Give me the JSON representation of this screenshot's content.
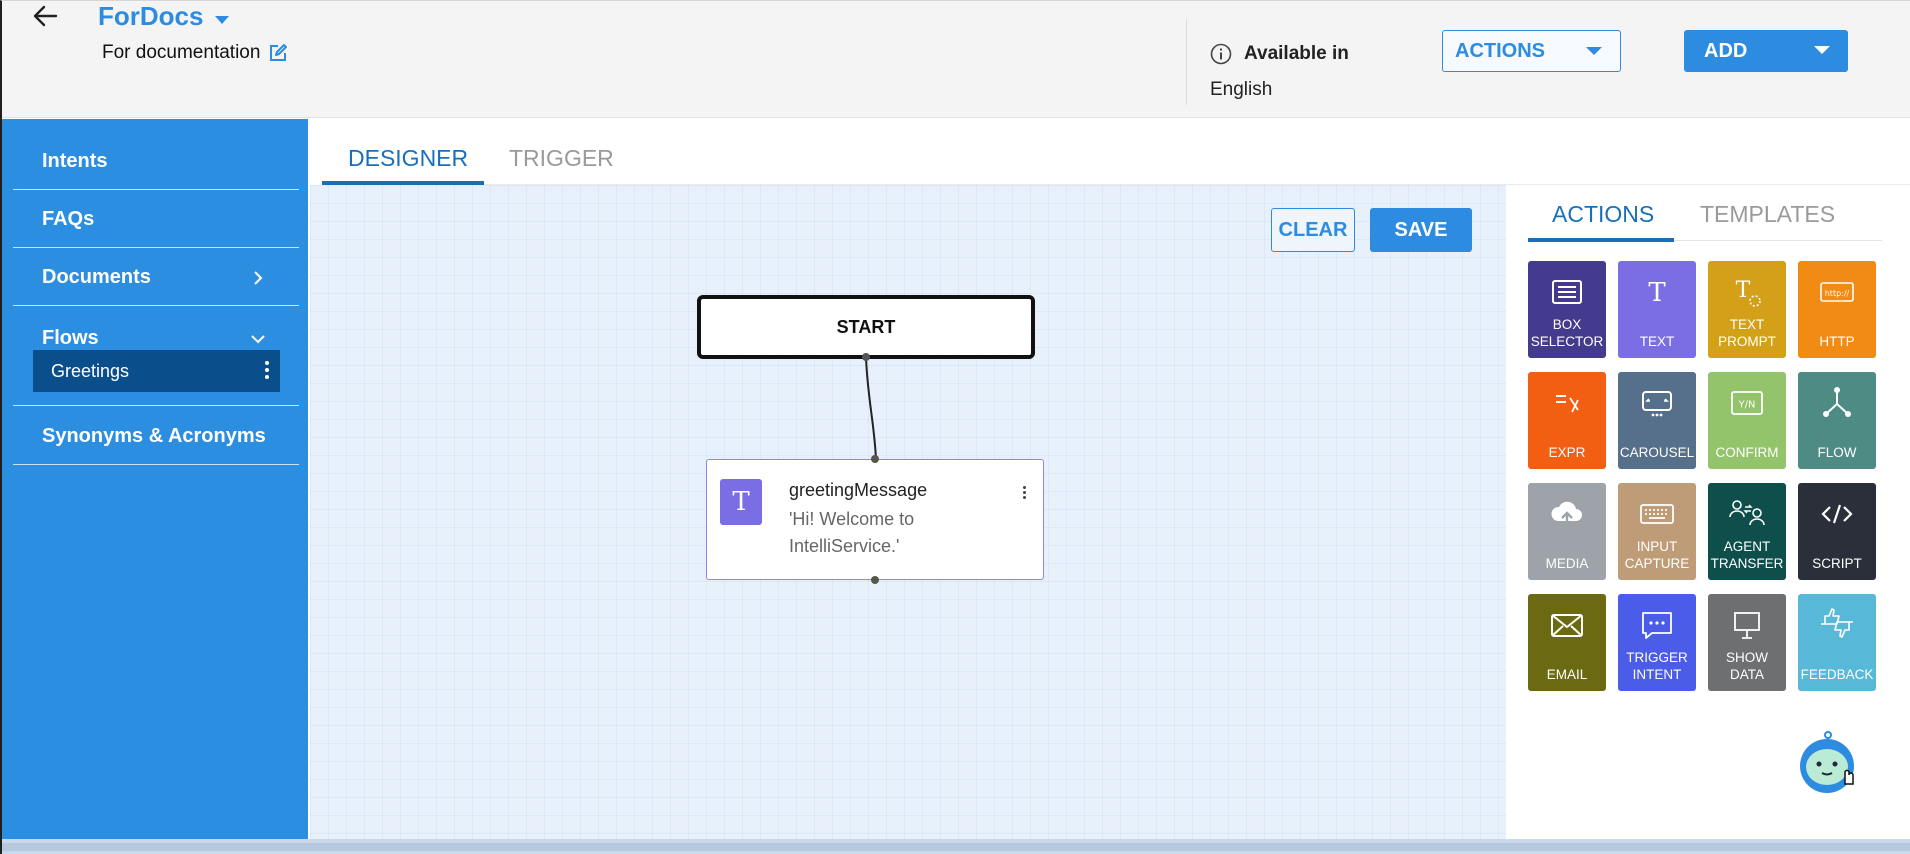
{
  "header": {
    "title": "ForDocs",
    "subtitle": "For documentation",
    "available_label": "Available in",
    "available_language": "English",
    "actions_label": "ACTIONS",
    "add_label": "ADD"
  },
  "sidebar": {
    "items": [
      {
        "label": "Intents"
      },
      {
        "label": "FAQs"
      },
      {
        "label": "Documents"
      },
      {
        "label": "Flows"
      },
      {
        "label": "Synonyms & Acronyms"
      }
    ],
    "flows_children": [
      {
        "label": "Greetings"
      }
    ]
  },
  "main": {
    "tabs": [
      {
        "label": "DESIGNER"
      },
      {
        "label": "TRIGGER"
      }
    ],
    "clear_label": "CLEAR",
    "save_label": "SAVE"
  },
  "canvas": {
    "start_label": "START",
    "nodes": [
      {
        "icon_letter": "T",
        "title": "greetingMessage",
        "text": "'Hi! Welcome to IntelliService.'"
      }
    ]
  },
  "right_panel": {
    "tabs": [
      {
        "label": "ACTIONS"
      },
      {
        "label": "TEMPLATES"
      }
    ],
    "tiles": [
      {
        "label": "BOX SELECTOR",
        "color": "#443a8e",
        "icon": "list-box-icon"
      },
      {
        "label": "TEXT",
        "color": "#7b6ee5",
        "icon": "text-icon"
      },
      {
        "label": "TEXT PROMPT",
        "color": "#d4a017",
        "icon": "text-prompt-icon"
      },
      {
        "label": "HTTP",
        "color": "#f28b13",
        "icon": "http-icon"
      },
      {
        "label": "EXPR",
        "color": "#f25f13",
        "icon": "expression-icon"
      },
      {
        "label": "CAROUSEL",
        "color": "#566f8a",
        "icon": "carousel-icon"
      },
      {
        "label": "CONFIRM",
        "color": "#93c36b",
        "icon": "confirm-icon"
      },
      {
        "label": "FLOW",
        "color": "#4e8b85",
        "icon": "flow-icon"
      },
      {
        "label": "MEDIA",
        "color": "#9da3a8",
        "icon": "cloud-upload-icon"
      },
      {
        "label": "INPUT CAPTURE",
        "color": "#bf9c78",
        "icon": "keyboard-icon"
      },
      {
        "label": "AGENT TRANSFER",
        "color": "#0f4f4b",
        "icon": "agent-transfer-icon"
      },
      {
        "label": "SCRIPT",
        "color": "#2b2f3a",
        "icon": "code-icon"
      },
      {
        "label": "EMAIL",
        "color": "#6b6a13",
        "icon": "email-icon"
      },
      {
        "label": "TRIGGER INTENT",
        "color": "#4a5ce8",
        "icon": "chat-bubble-icon"
      },
      {
        "label": "SHOW DATA",
        "color": "#6d6f70",
        "icon": "presentation-icon"
      },
      {
        "label": "FEEDBACK",
        "color": "#58b8d8",
        "icon": "thumbs-icon"
      }
    ]
  },
  "colors": {
    "primary": "#2d8ce0",
    "sidebar_bg": "#2c8ee0",
    "sidebar_active": "#0a4f8c",
    "canvas_bg": "#e8f1fb"
  }
}
